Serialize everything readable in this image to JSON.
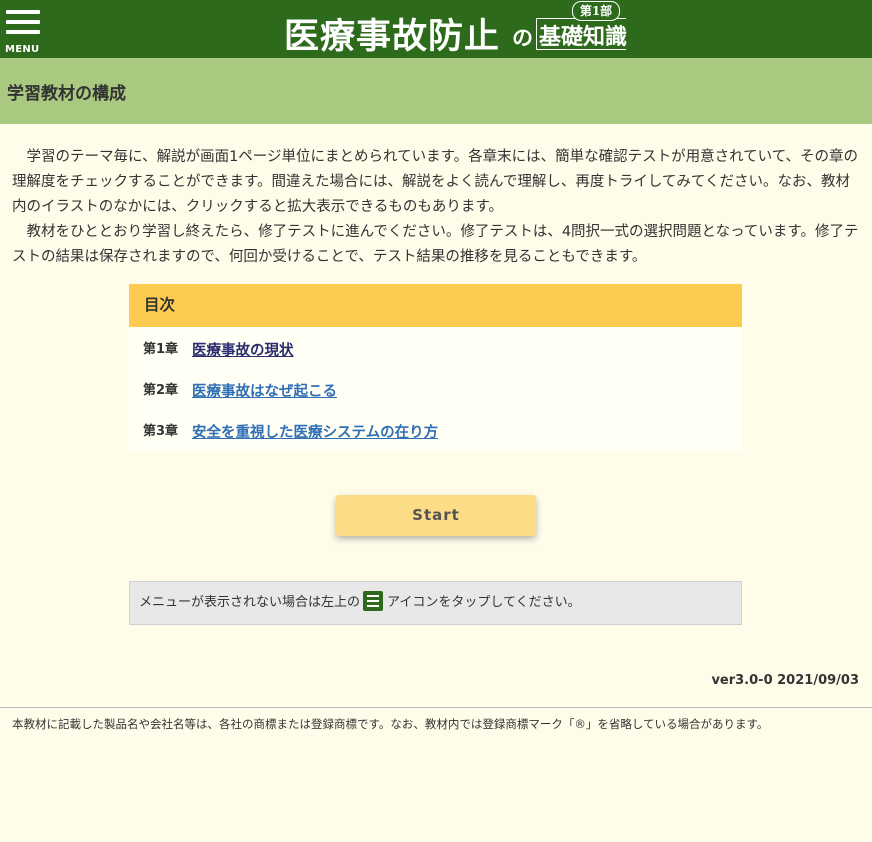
{
  "header": {
    "menu_label": "MENU",
    "logo": {
      "title_main": "医療事故防止",
      "title_no": "の",
      "title_sub": "基礎知識",
      "part_label": "第1部"
    }
  },
  "section": {
    "title": "学習教材の構成"
  },
  "intro": {
    "paragraph1": "学習のテーマ毎に、解説が画面1ページ単位にまとめられています。各章末には、簡単な確認テストが用意されていて、その章の理解度をチェックすることができます。間違えた場合には、解説をよく読んで理解し、再度トライしてみてください。なお、教材内のイラストのなかには、クリックすると拡大表示できるものもあります。",
    "paragraph2": "教材をひととおり学習し終えたら、修了テストに進んでください。修了テストは、4問択一式の選択問題となっています。修了テストの結果は保存されますので、何回か受けることで、テスト結果の推移を見ることもできます。"
  },
  "toc": {
    "heading": "目次",
    "items": [
      {
        "number": "第1章",
        "title": "医療事故の現状",
        "visited": true
      },
      {
        "number": "第2章",
        "title": "医療事故はなぜ起こる",
        "visited": false
      },
      {
        "number": "第3章",
        "title": "安全を重視した医療システムの在り方",
        "visited": false
      }
    ]
  },
  "start_button": {
    "label": "Start"
  },
  "notice": {
    "text_before": "メニューが表示されない場合は左上の",
    "icon": "menu-icon",
    "text_after": "アイコンをタップしてください。"
  },
  "version": "ver3.0-0 2021/09/03",
  "footer": {
    "trademark_note": "本教材に記載した製品名や会社名等は、各社の商標または登録商標です。なお、教材内では登録商標マーク「®」を省略している場合があります。"
  },
  "colors": {
    "header_bg": "#2d6a1b",
    "subheader_bg": "#a8c97f",
    "toc_head_bg": "#fdcb4f",
    "start_bg": "#fddc87",
    "link_visited": "#2c2c6e",
    "link": "#2f6fb6",
    "page_bg": "#fffdea"
  }
}
